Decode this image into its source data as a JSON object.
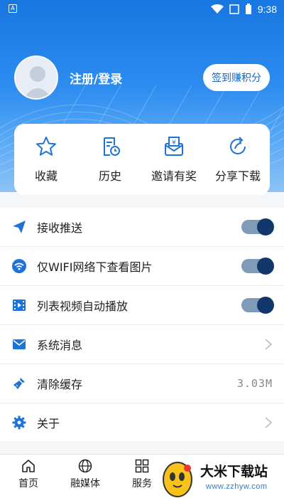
{
  "status_bar": {
    "time": "9:38"
  },
  "profile": {
    "login_label": "注册/登录",
    "sign_button": "签到赚积分"
  },
  "quick_actions": [
    {
      "label": "收藏",
      "icon": "star-icon"
    },
    {
      "label": "历史",
      "icon": "history-icon"
    },
    {
      "label": "邀请有奖",
      "icon": "invite-icon"
    },
    {
      "label": "分享下载",
      "icon": "share-icon"
    }
  ],
  "settings": [
    {
      "label": "接收推送",
      "icon": "send-icon",
      "control": "toggle",
      "on": true
    },
    {
      "label": "仅WIFI网络下查看图片",
      "icon": "wifi-icon",
      "control": "toggle",
      "on": true
    },
    {
      "label": "列表视频自动播放",
      "icon": "video-icon",
      "control": "toggle",
      "on": true
    },
    {
      "label": "系统消息",
      "icon": "mail-icon",
      "control": "chevron"
    },
    {
      "label": "清除缓存",
      "icon": "broom-icon",
      "control": "value",
      "value": "3.03M"
    },
    {
      "label": "关于",
      "icon": "gear-icon",
      "control": "chevron"
    }
  ],
  "bottom_nav": [
    {
      "label": "首页",
      "icon": "home-icon"
    },
    {
      "label": "融媒体",
      "icon": "globe-icon"
    },
    {
      "label": "服务",
      "icon": "grid-icon"
    }
  ],
  "watermark": {
    "title": "大米下载站",
    "url": "www.zzhyw.com"
  },
  "colors": {
    "accent": "#1e73d8",
    "toggle_knob": "#12386b",
    "toggle_track": "#7f9bb8",
    "icon_blue": "#1e73d8"
  }
}
